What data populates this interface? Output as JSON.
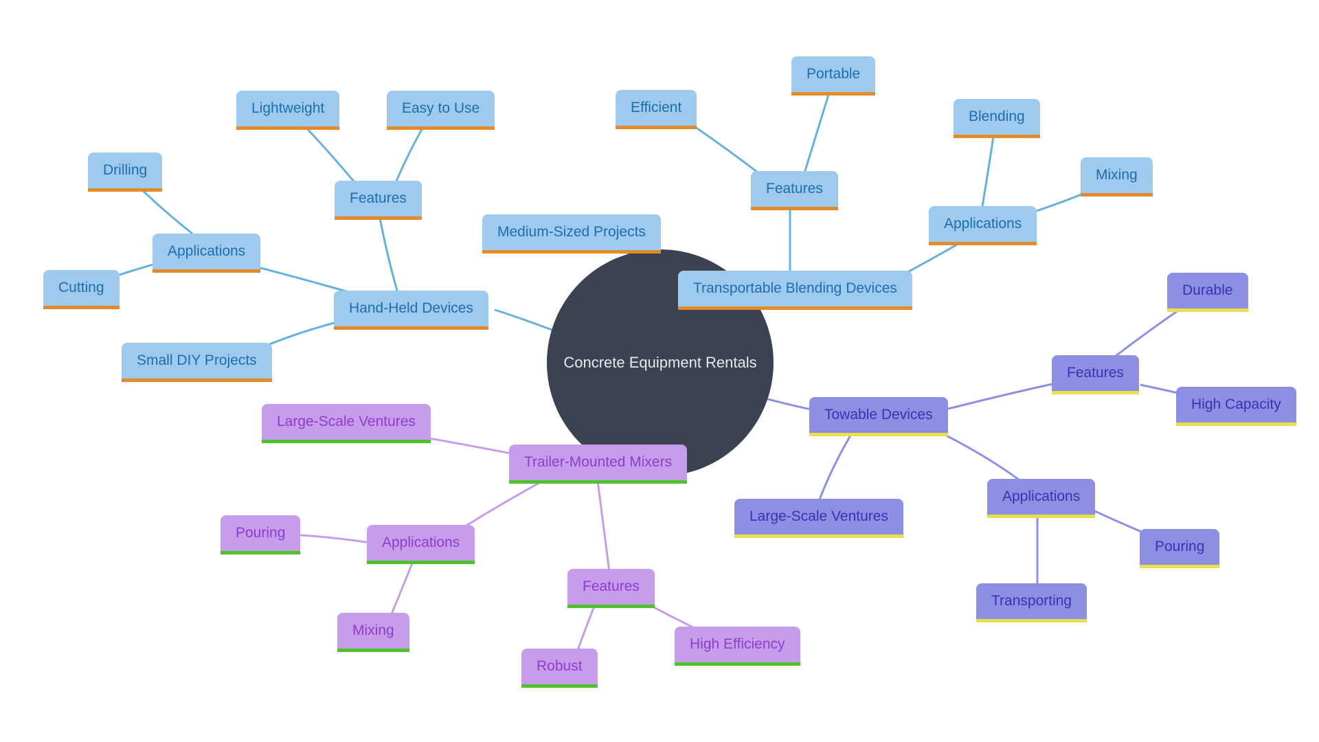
{
  "center": {
    "label": "Concrete Equipment Rentals"
  },
  "branches": {
    "handHeld": {
      "label": "Hand-Held Devices",
      "children": {
        "smallDIY": {
          "label": "Small DIY Projects"
        },
        "features": {
          "label": "Features",
          "children": {
            "lightweight": {
              "label": "Lightweight"
            },
            "easyUse": {
              "label": "Easy to Use"
            }
          }
        },
        "applications": {
          "label": "Applications",
          "children": {
            "drilling": {
              "label": "Drilling"
            },
            "cutting": {
              "label": "Cutting"
            }
          }
        }
      }
    },
    "transportable": {
      "label": "Transportable Blending Devices",
      "children": {
        "mediumSized": {
          "label": "Medium-Sized Projects"
        },
        "features": {
          "label": "Features",
          "children": {
            "efficient": {
              "label": "Efficient"
            },
            "portable": {
              "label": "Portable"
            }
          }
        },
        "applications": {
          "label": "Applications",
          "children": {
            "blending": {
              "label": "Blending"
            },
            "mixing": {
              "label": "Mixing"
            }
          }
        }
      }
    },
    "towable": {
      "label": "Towable Devices",
      "children": {
        "largeScale": {
          "label": "Large-Scale Ventures"
        },
        "features": {
          "label": "Features",
          "children": {
            "durable": {
              "label": "Durable"
            },
            "highCapacity": {
              "label": "High Capacity"
            }
          }
        },
        "applications": {
          "label": "Applications",
          "children": {
            "transporting": {
              "label": "Transporting"
            },
            "pouring": {
              "label": "Pouring"
            }
          }
        }
      }
    },
    "trailerMounted": {
      "label": "Trailer-Mounted Mixers",
      "children": {
        "largeScale": {
          "label": "Large-Scale Ventures"
        },
        "features": {
          "label": "Features",
          "children": {
            "robust": {
              "label": "Robust"
            },
            "highEfficiency": {
              "label": "High Efficiency"
            }
          }
        },
        "applications": {
          "label": "Applications",
          "children": {
            "pouring": {
              "label": "Pouring"
            },
            "mixing": {
              "label": "Mixing"
            }
          }
        }
      }
    }
  },
  "colors": {
    "blueStroke": "#66b0dd",
    "purpleStroke": "#c79cea",
    "indigoStroke": "#8d8fe2"
  }
}
